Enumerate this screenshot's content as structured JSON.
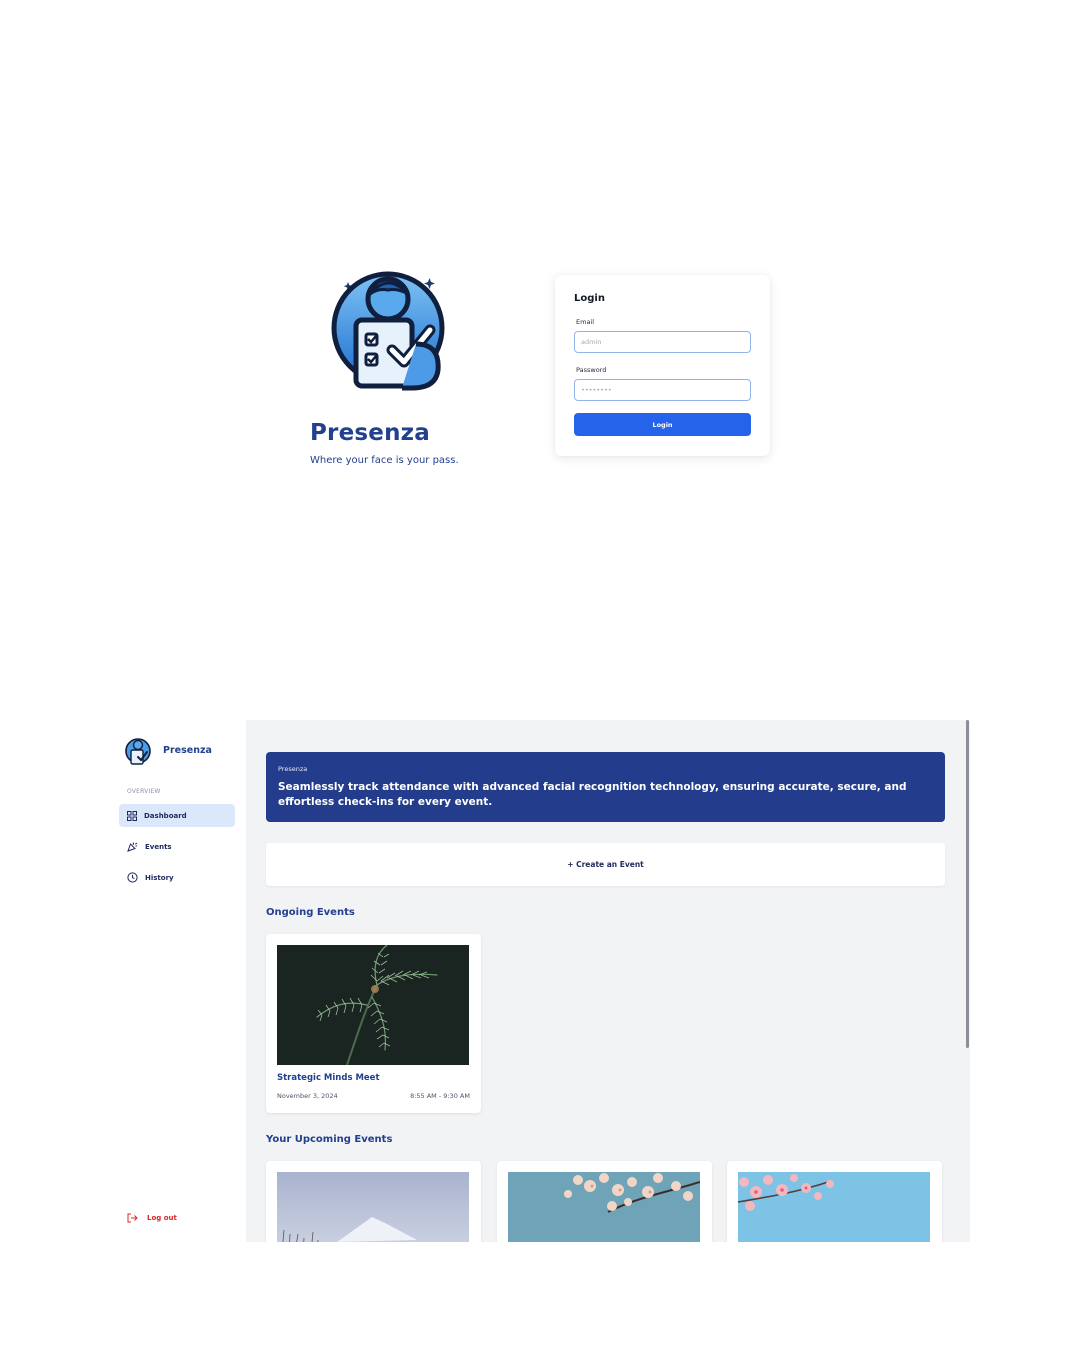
{
  "login": {
    "brand_name": "Presenza",
    "tagline": "Where your face is your pass.",
    "form_title": "Login",
    "email_label": "Email",
    "email_placeholder": "admin",
    "password_label": "Password",
    "password_placeholder": "••••••••",
    "submit_label": "Login"
  },
  "sidebar": {
    "brand_name": "Presenza",
    "section_label": "OVERVIEW",
    "items": [
      {
        "label": "Dashboard",
        "icon": "grid-icon",
        "active": true
      },
      {
        "label": "Events",
        "icon": "party-popper-icon",
        "active": false
      },
      {
        "label": "History",
        "icon": "clock-icon",
        "active": false
      }
    ],
    "logout_label": "Log out"
  },
  "hero": {
    "kicker": "Presenza",
    "text": "Seamlessly track attendance with advanced facial recognition technology, ensuring accurate, secure, and effortless check-ins for every event."
  },
  "create_event_label": "+ Create an Event",
  "ongoing": {
    "title": "Ongoing Events",
    "events": [
      {
        "name": "Strategic Minds Meet",
        "date": "November 3, 2024",
        "time": "8:55 AM - 9:30 AM"
      }
    ]
  },
  "upcoming": {
    "title": "Your Upcoming Events"
  },
  "colors": {
    "brand_navy": "#233d8c",
    "primary_blue": "#2563eb",
    "danger_red": "#dc2626",
    "main_bg": "#f2f3f5"
  }
}
